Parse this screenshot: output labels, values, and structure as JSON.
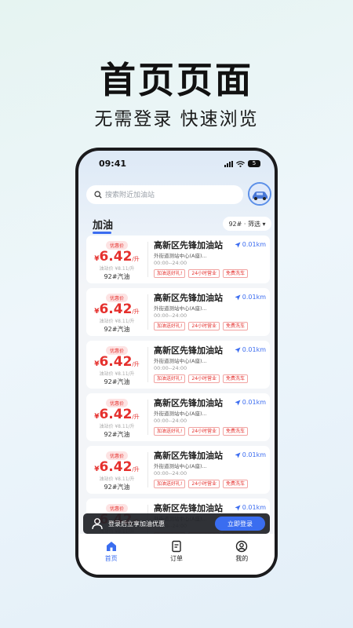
{
  "promo": {
    "headline": "首页页面",
    "subline": "无需登录 快速浏览"
  },
  "status": {
    "time": "09:41",
    "battery": "5"
  },
  "search": {
    "placeholder": "搜索附近加油站"
  },
  "section": {
    "title": "加油",
    "filter_label": "92# · 筛选 ▾"
  },
  "stations": [
    {
      "promo_badge": "优惠价",
      "currency": "¥",
      "price": "6.42",
      "unit": "/升",
      "original_price": "油站价 ¥8.11/升",
      "fuel_type": "92#汽油",
      "name": "高新区先锋加油站",
      "distance": "0.01km",
      "address": "外街道测站中心(A座)...",
      "hours": "00:00--24:00",
      "tags": [
        "加油送好礼!",
        "24小时营业",
        "免费洗车"
      ]
    },
    {
      "promo_badge": "优惠价",
      "currency": "¥",
      "price": "6.42",
      "unit": "/升",
      "original_price": "油站价 ¥8.11/升",
      "fuel_type": "92#汽油",
      "name": "高新区先锋加油站",
      "distance": "0.01km",
      "address": "外街道测站中心(A座)...",
      "hours": "00:00--24:00",
      "tags": [
        "加油送好礼!",
        "24小时营业",
        "免费洗车"
      ]
    },
    {
      "promo_badge": "优惠价",
      "currency": "¥",
      "price": "6.42",
      "unit": "/升",
      "original_price": "油站价 ¥8.11/升",
      "fuel_type": "92#汽油",
      "name": "高新区先锋加油站",
      "distance": "0.01km",
      "address": "外街道测站中心(A座)...",
      "hours": "00:00--24:00",
      "tags": [
        "加油送好礼!",
        "24小时营业",
        "免费洗车"
      ]
    },
    {
      "promo_badge": "优惠价",
      "currency": "¥",
      "price": "6.42",
      "unit": "/升",
      "original_price": "油站价 ¥8.11/升",
      "fuel_type": "92#汽油",
      "name": "高新区先锋加油站",
      "distance": "0.01km",
      "address": "外街道测站中心(A座)...",
      "hours": "00:00--24:00",
      "tags": [
        "加油送好礼!",
        "24小时营业",
        "免费洗车"
      ]
    },
    {
      "promo_badge": "优惠价",
      "currency": "¥",
      "price": "6.42",
      "unit": "/升",
      "original_price": "油站价 ¥8.11/升",
      "fuel_type": "92#汽油",
      "name": "高新区先锋加油站",
      "distance": "0.01km",
      "address": "外街道测站中心(A座)...",
      "hours": "00:00--24:00",
      "tags": [
        "加油送好礼!",
        "24小时营业",
        "免费洗车"
      ]
    },
    {
      "promo_badge": "优惠价",
      "currency": "¥",
      "price": "6.42",
      "unit": "/升",
      "original_price": "油站价 ¥8.11/升",
      "fuel_type": "92#汽油",
      "name": "高新区先锋加油站",
      "distance": "0.01km",
      "address": "外街道测站中心(A座)...",
      "hours": "00:00--24:00",
      "tags": [
        "加油送好礼!",
        "24小时营业",
        "免费洗车"
      ]
    }
  ],
  "login_banner": {
    "text": "登录后立享加油优惠",
    "button": "立即登录"
  },
  "tabbar": [
    {
      "label": "首页",
      "icon": "home-icon",
      "active": true
    },
    {
      "label": "订单",
      "icon": "order-icon",
      "active": false
    },
    {
      "label": "我的",
      "icon": "profile-icon",
      "active": false
    }
  ],
  "colors": {
    "accent": "#3a6df0",
    "price": "#e5302d"
  }
}
